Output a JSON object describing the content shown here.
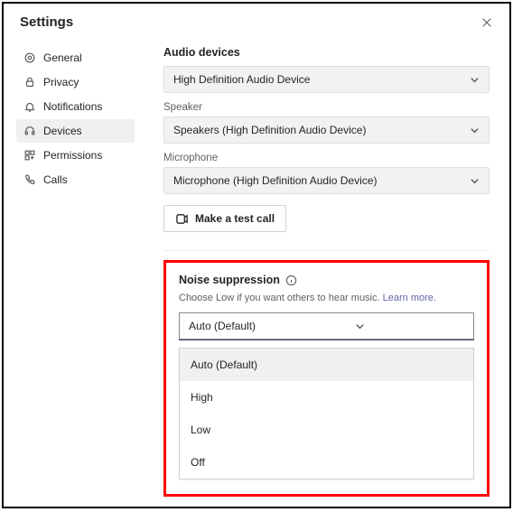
{
  "header": {
    "title": "Settings"
  },
  "sidebar": {
    "items": [
      {
        "label": "General"
      },
      {
        "label": "Privacy"
      },
      {
        "label": "Notifications"
      },
      {
        "label": "Devices"
      },
      {
        "label": "Permissions"
      },
      {
        "label": "Calls"
      }
    ]
  },
  "audio": {
    "title": "Audio devices",
    "device_selected": "High Definition Audio Device",
    "speaker_label": "Speaker",
    "speaker_selected": "Speakers (High Definition Audio Device)",
    "microphone_label": "Microphone",
    "microphone_selected": "Microphone (High Definition Audio Device)",
    "test_button": "Make a test call"
  },
  "noise": {
    "title": "Noise suppression",
    "help_text": "Choose Low if you want others to hear music.",
    "learn_more": "Learn more.",
    "selected": "Auto (Default)",
    "options": [
      {
        "label": "Auto (Default)"
      },
      {
        "label": "High"
      },
      {
        "label": "Low"
      },
      {
        "label": "Off"
      }
    ]
  }
}
